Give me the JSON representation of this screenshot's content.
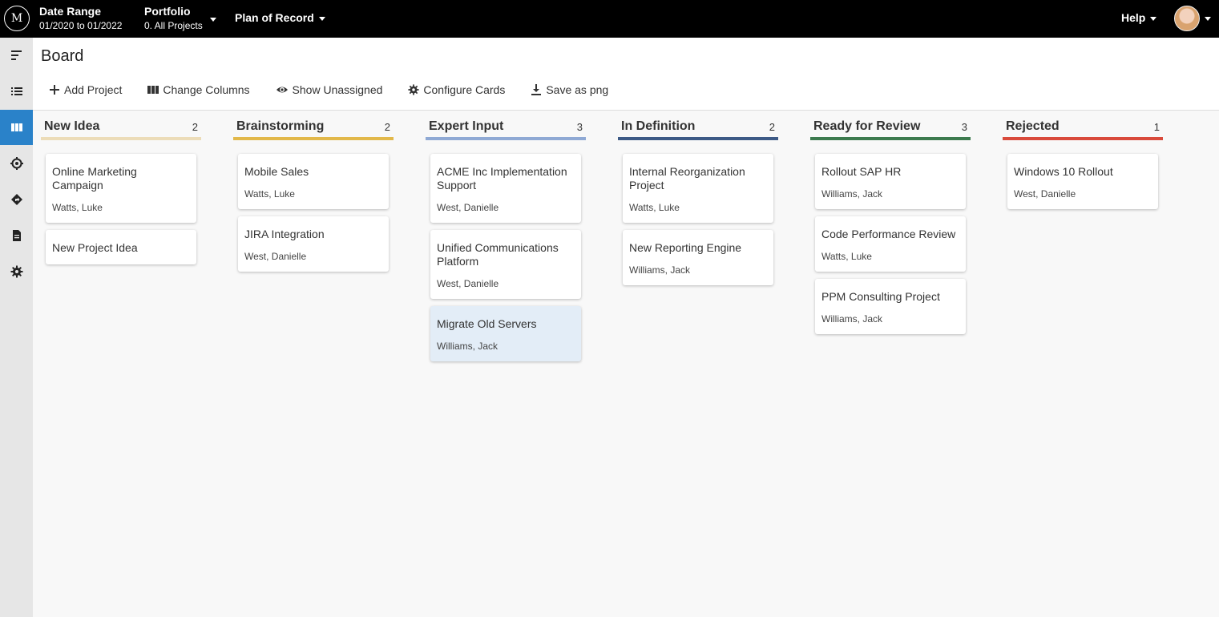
{
  "header": {
    "logo_text": "M",
    "date_range_title": "Date Range",
    "date_range_value": "01/2020 to 01/2022",
    "portfolio_title": "Portfolio",
    "portfolio_value": "0. All Projects",
    "plan_label": "Plan of Record",
    "help_label": "Help"
  },
  "sidebar": {
    "items": [
      {
        "name": "menu-icon"
      },
      {
        "name": "list-icon"
      },
      {
        "name": "board-icon",
        "active": true
      },
      {
        "name": "target-icon"
      },
      {
        "name": "roadmap-icon"
      },
      {
        "name": "document-icon"
      },
      {
        "name": "gear-icon"
      }
    ]
  },
  "page": {
    "title": "Board",
    "toolbar": {
      "add_project": "Add Project",
      "change_columns": "Change Columns",
      "show_unassigned": "Show Unassigned",
      "configure_cards": "Configure Cards",
      "save_png": "Save as png"
    }
  },
  "columns": [
    {
      "title": "New Idea",
      "count": "2",
      "color": "#ecdcb8",
      "cards": [
        {
          "title": "Online Marketing Campaign",
          "owner": "Watts, Luke"
        },
        {
          "title": "New Project Idea",
          "owner": ""
        }
      ]
    },
    {
      "title": "Brainstorming",
      "count": "2",
      "color": "#e2b84a",
      "cards": [
        {
          "title": "Mobile Sales",
          "owner": "Watts, Luke"
        },
        {
          "title": "JIRA Integration",
          "owner": "West, Danielle"
        }
      ]
    },
    {
      "title": "Expert Input",
      "count": "3",
      "color": "#8fa9d4",
      "cards": [
        {
          "title": "ACME Inc Implementation Support",
          "owner": "West, Danielle"
        },
        {
          "title": "Unified Communications Platform",
          "owner": "West, Danielle"
        },
        {
          "title": "Migrate Old Servers",
          "owner": "Williams, Jack",
          "selected": true
        }
      ]
    },
    {
      "title": "In Definition",
      "count": "2",
      "color": "#3d5a86",
      "cards": [
        {
          "title": "Internal Reorganization Project",
          "owner": "Watts, Luke"
        },
        {
          "title": "New Reporting Engine",
          "owner": "Williams, Jack"
        }
      ]
    },
    {
      "title": "Ready for Review",
      "count": "3",
      "color": "#3c7a4e",
      "cards": [
        {
          "title": "Rollout SAP HR",
          "owner": "Williams, Jack"
        },
        {
          "title": "Code Performance Review",
          "owner": "Watts, Luke"
        },
        {
          "title": "PPM Consulting Project",
          "owner": "Williams, Jack"
        }
      ]
    },
    {
      "title": "Rejected",
      "count": "1",
      "color": "#d94a3b",
      "cards": [
        {
          "title": "Windows 10 Rollout",
          "owner": "West, Danielle"
        }
      ]
    }
  ]
}
